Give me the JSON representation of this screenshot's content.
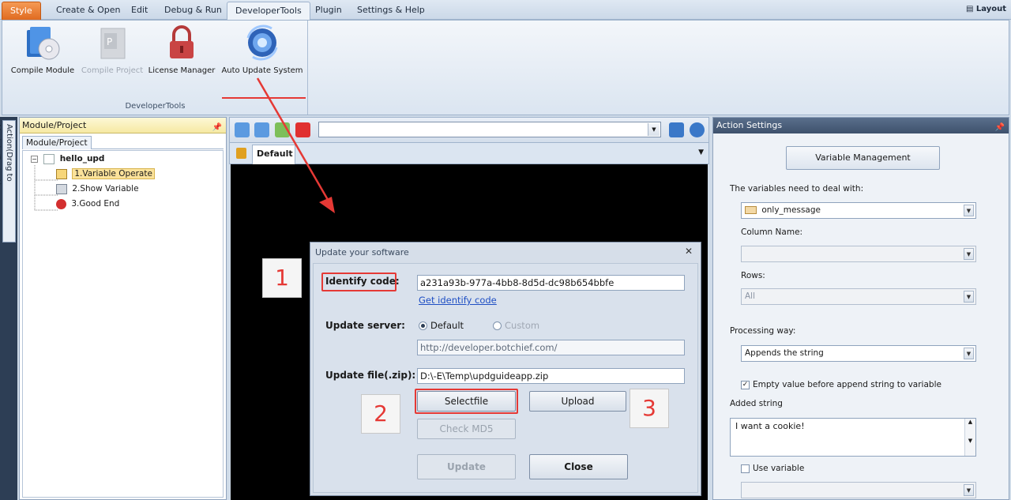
{
  "ribbon": {
    "tabs": [
      "Style",
      "Create & Open",
      "Edit",
      "Debug & Run",
      "DeveloperTools",
      "Plugin",
      "Settings & Help"
    ],
    "layout_label": "Layout",
    "group_label": "DeveloperTools",
    "buttons": [
      {
        "label": "Compile Module",
        "icon": "compile-module-icon",
        "enabled": true
      },
      {
        "label": "Compile Project",
        "icon": "compile-project-icon",
        "enabled": false
      },
      {
        "label": "License Manager",
        "icon": "lock-icon",
        "enabled": true
      },
      {
        "label": "Auto Update System",
        "icon": "auto-update-icon",
        "enabled": true
      }
    ]
  },
  "side_tab": "Action(Drag to Module/Project)",
  "module_panel": {
    "title": "Module/Project",
    "subtab": "Module/Project",
    "tree": {
      "root": "hello_upd",
      "items": [
        "1.Variable Operate",
        "2.Show Variable",
        "3.Good End"
      ]
    }
  },
  "center": {
    "address_value": "",
    "doc_tab": "Default"
  },
  "action_settings": {
    "title": "Action Settings",
    "variable_management": "Variable Management",
    "variables_label": "The variables need to deal with:",
    "variable_value": "only_message",
    "column_label": "Column Name:",
    "column_value": "",
    "rows_label": "Rows:",
    "rows_value": "All",
    "processing_label": "Processing way:",
    "processing_value": "Appends the string",
    "empty_checkbox": "Empty value before append string to variable",
    "added_label": "Added string",
    "added_value": "I want a cookie!",
    "use_variable": "Use variable"
  },
  "dialog": {
    "title": "Update your software",
    "identify_label": "Identify code:",
    "identify_value": "a231a93b-977a-4bb8-8d5d-dc98b654bbfe",
    "get_identify": "Get identify code",
    "server_label": "Update server:",
    "radio_default": "Default",
    "radio_custom": "Custom",
    "server_value": "http://developer.botchief.com/",
    "file_label": "Update file(.zip):",
    "file_value": "D:\\-E\\Temp\\updguideapp.zip",
    "select_file": "Selectfile",
    "upload": "Upload",
    "check_md5": "Check MD5",
    "update": "Update",
    "close": "Close"
  },
  "steps": [
    "1",
    "2",
    "3"
  ],
  "colors": {
    "highlight": "#e53935",
    "style_tab": "#e06b20"
  }
}
